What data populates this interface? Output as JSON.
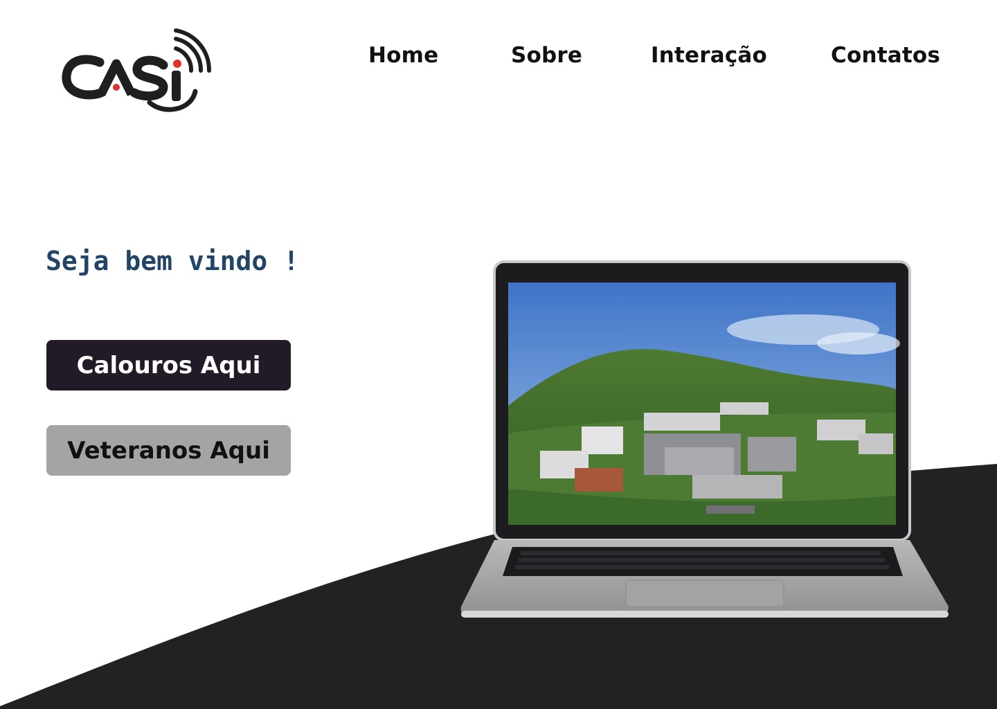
{
  "brand": {
    "logo_text": "CASI"
  },
  "nav": {
    "items": [
      {
        "label": "Home"
      },
      {
        "label": "Sobre"
      },
      {
        "label": "Interação"
      },
      {
        "label": "Contatos"
      }
    ]
  },
  "hero": {
    "welcome": "Seja bem vindo !",
    "buttons": {
      "calouros": "Calouros Aqui",
      "veteranos": "Veteranos Aqui"
    },
    "image": "laptop-campus-aerial-photo"
  },
  "colors": {
    "welcome_text": "#224466",
    "primary_button": "#221a27",
    "secondary_button": "#a4a4a4",
    "dark_wave": "#222224",
    "logo_accent": "#e03030"
  }
}
